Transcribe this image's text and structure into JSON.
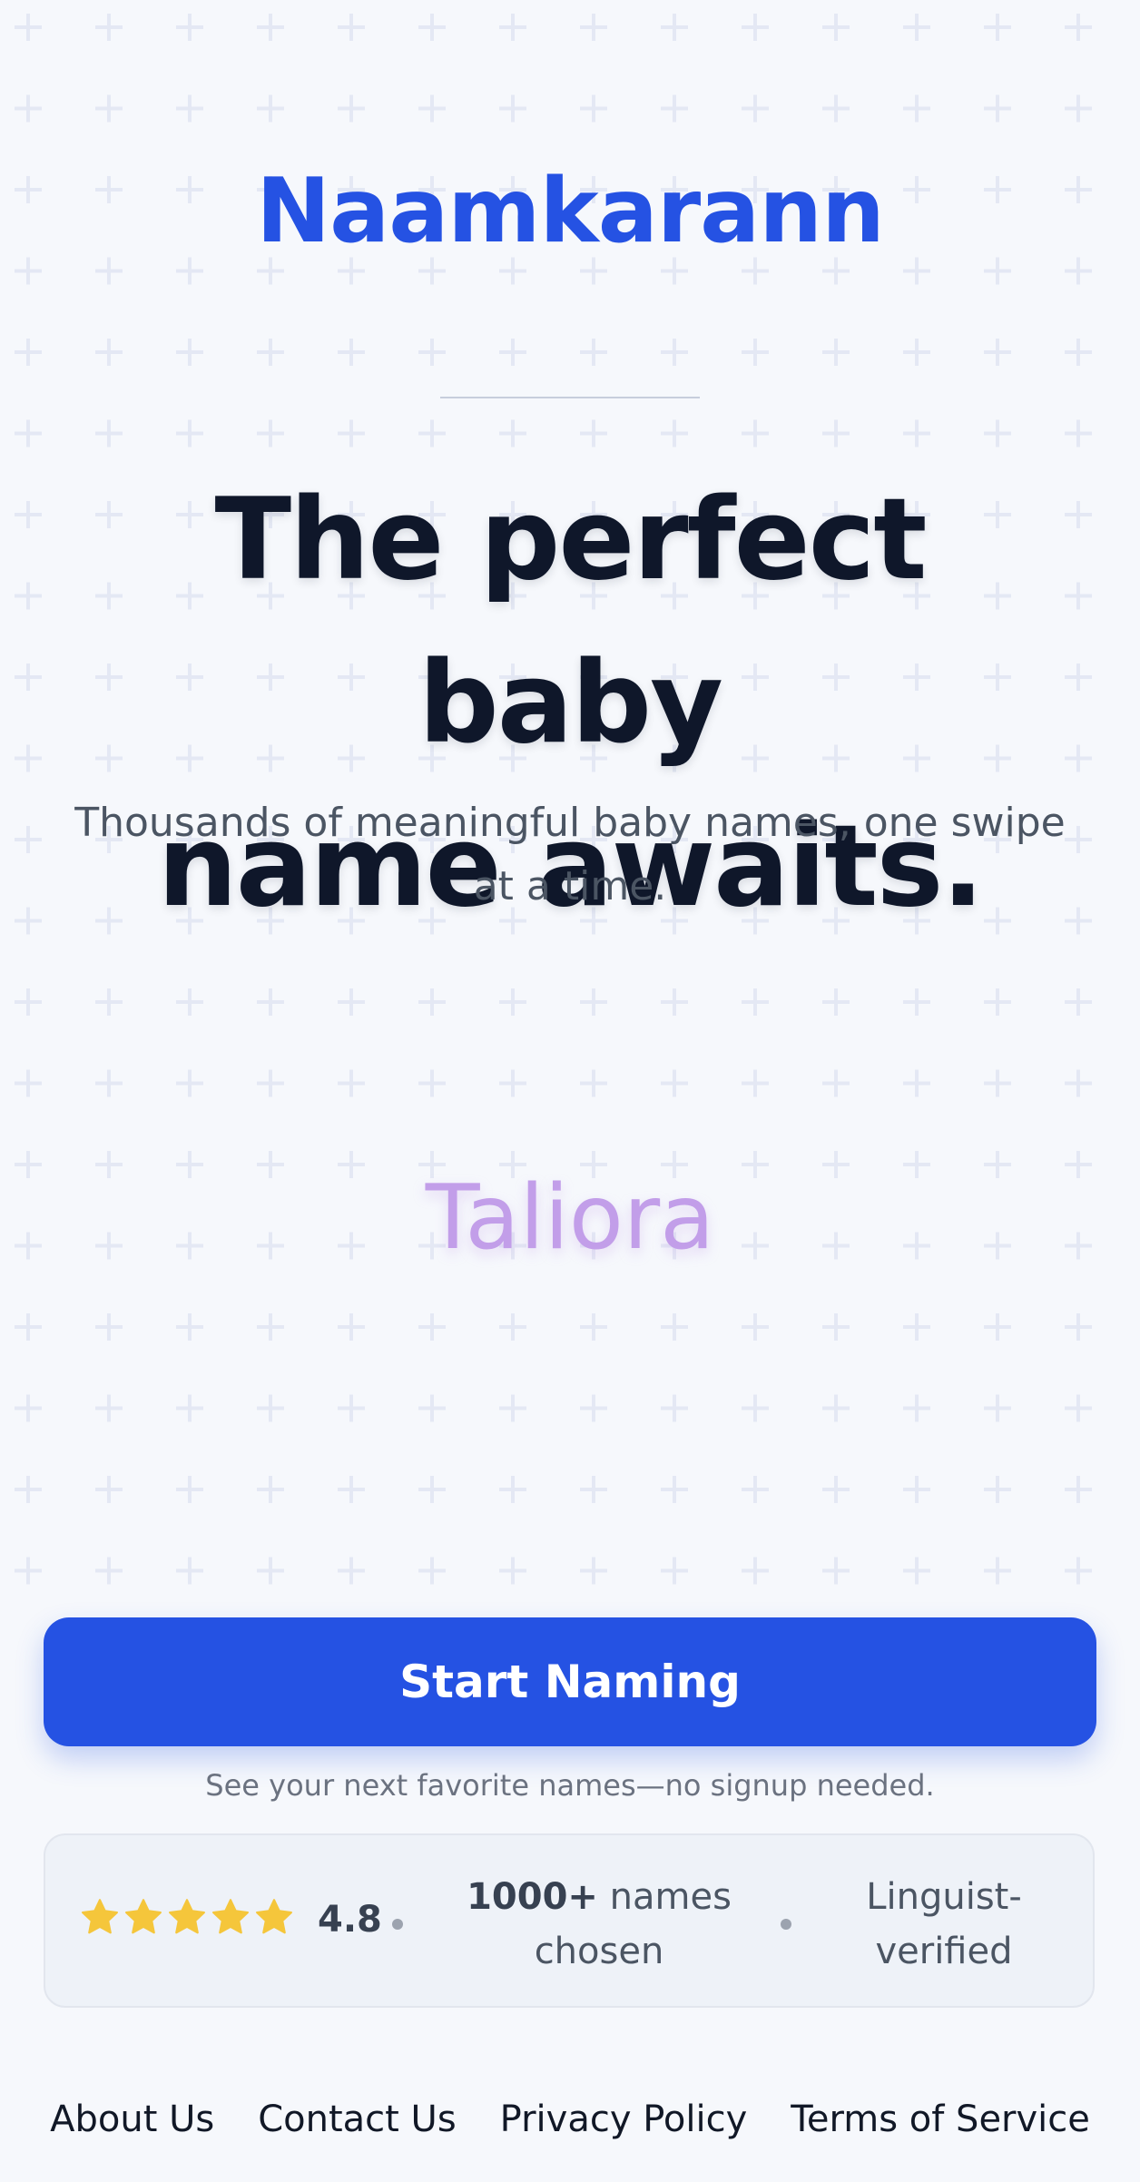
{
  "header": {
    "brand": "Naamkarann"
  },
  "hero": {
    "headline_line1": "The perfect baby",
    "headline_line2": "name awaits.",
    "subtitle": "Thousands of meaningful baby names, one swipe at a time.",
    "preview_name": "Taliora"
  },
  "cta": {
    "button_label": "Start Naming",
    "note": "See your next favorite names—no signup needed."
  },
  "stats": {
    "star_count": 5,
    "rating": "4.8",
    "names_count": "1000+",
    "names_label": "names chosen",
    "verified_label": "Linguist-verified"
  },
  "footer": {
    "links": [
      "About Us",
      "Contact Us",
      "Privacy Policy",
      "Terms of Service"
    ]
  },
  "colors": {
    "brand": "#2552e3",
    "background": "#f6f8fc",
    "preview_name": "#c29ee9",
    "star": "#f5c63b"
  },
  "icons": {
    "star": "star-icon",
    "background_pattern": "plus-pattern"
  }
}
